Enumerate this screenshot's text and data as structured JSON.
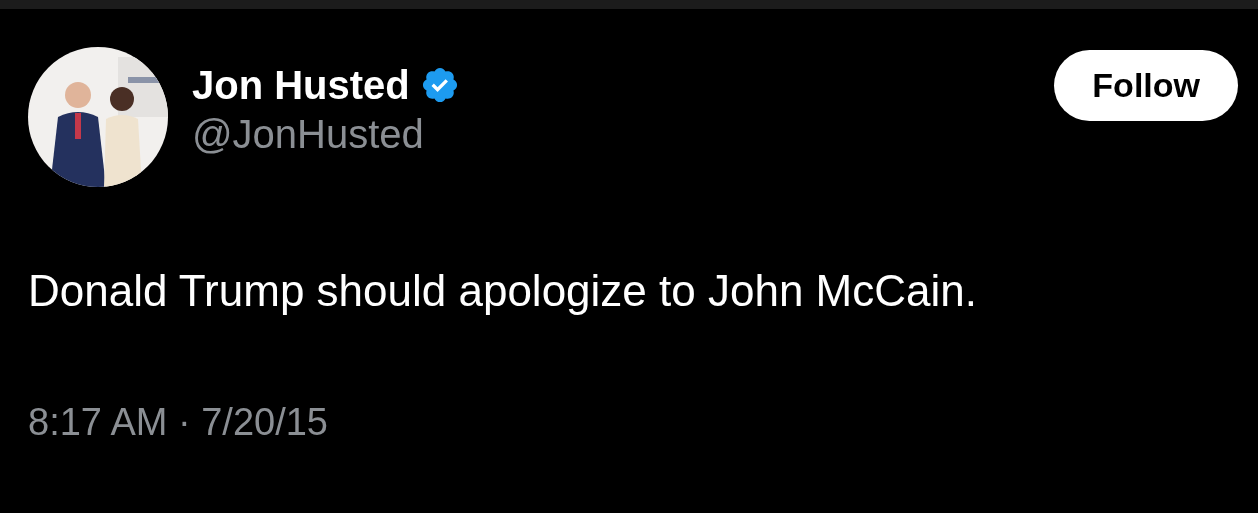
{
  "author": {
    "name": "Jon Husted",
    "verified": true,
    "handle": "@JonHusted"
  },
  "follow_button": {
    "label": "Follow"
  },
  "tweet": {
    "text": "Donald Trump should apologize to John McCain.",
    "timestamp": "8:17 AM · 7/20/15"
  }
}
